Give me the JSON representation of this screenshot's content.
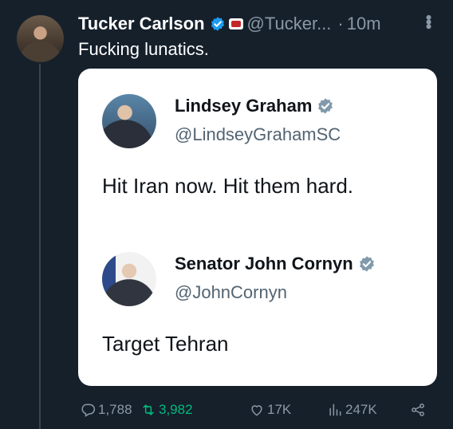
{
  "post": {
    "author_name": "Tucker Carlson",
    "handle": "@Tucker...",
    "separator": "·",
    "time": "10m",
    "text": "Fucking lunatics."
  },
  "quote_card": {
    "tweet1": {
      "author_name": "Lindsey Graham",
      "handle": "@LindseyGrahamSC",
      "text": "Hit Iran now. Hit them hard."
    },
    "tweet2": {
      "author_name": "Senator John Cornyn",
      "handle": "@JohnCornyn",
      "text": "Target Tehran"
    }
  },
  "actions": {
    "replies": "1,788",
    "reposts": "3,982",
    "likes": "17K",
    "views": "247K"
  },
  "colors": {
    "background": "#15202b",
    "verified_blue": "#1d9bf0",
    "verified_gray": "#829aab",
    "repost_green": "#00ba7c",
    "muted_text": "#8b98a5"
  },
  "icons": [
    "verified-badge-icon",
    "affiliation-badge-icon",
    "more-icon",
    "reply-icon",
    "repost-icon",
    "like-icon",
    "views-icon",
    "share-icon"
  ]
}
